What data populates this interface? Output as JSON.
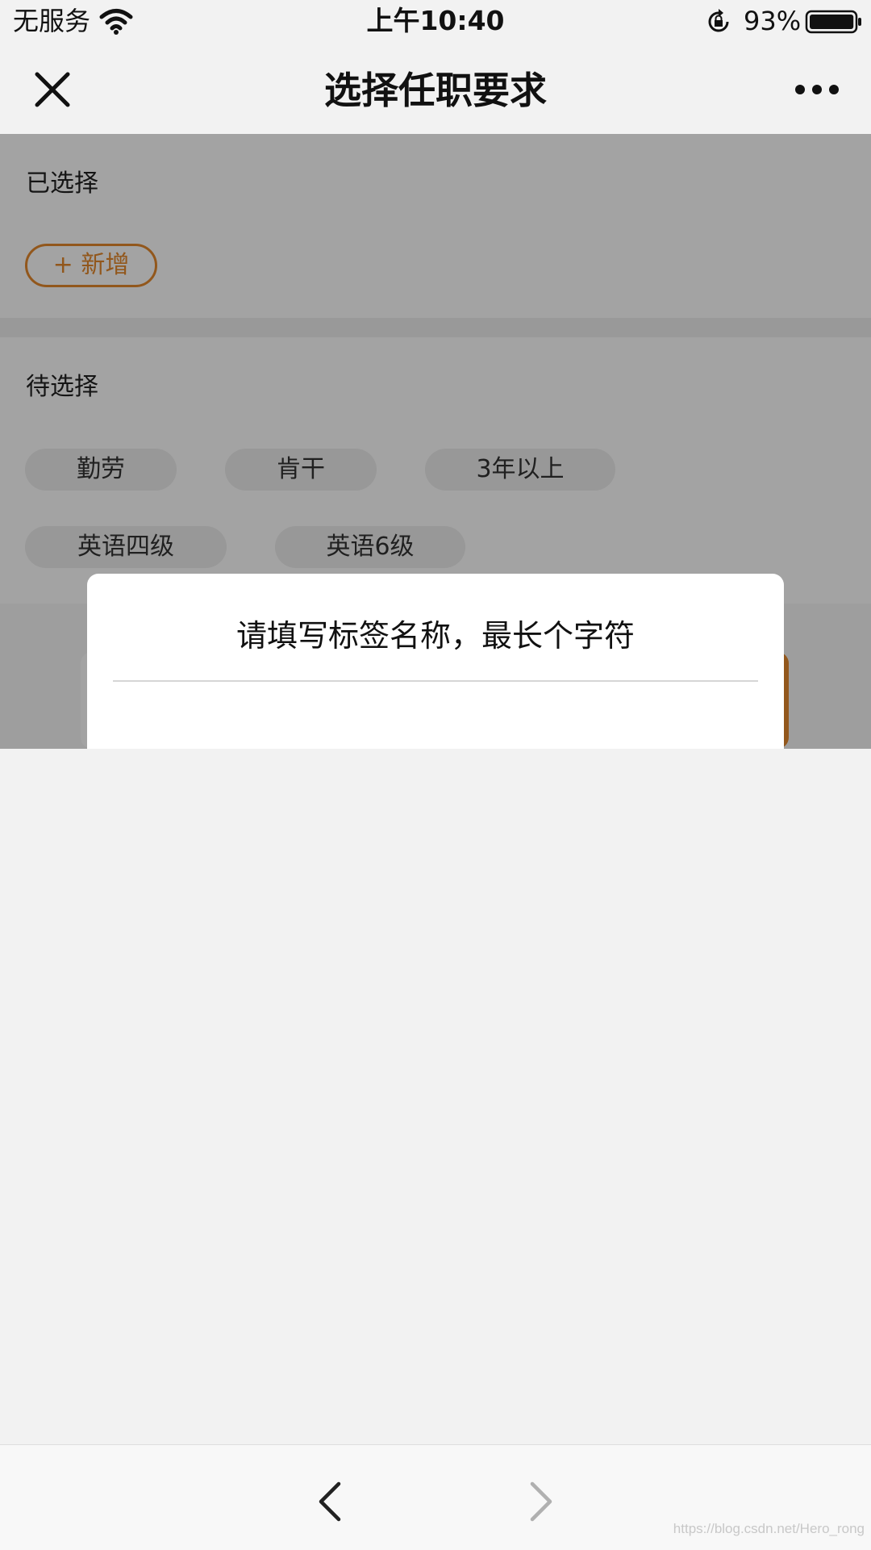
{
  "status_bar": {
    "carrier": "无服务",
    "time": "上午10:40",
    "battery_percent": "93%",
    "battery_level": 0.93
  },
  "nav": {
    "title": "选择任职要求",
    "close_icon": "close-icon",
    "more_icon": "more-icon"
  },
  "selected_section": {
    "label": "已选择",
    "add_button_label": "+ 新增"
  },
  "pending_section": {
    "label": "待选择",
    "tags": [
      "勤劳",
      "肯干",
      "3年以上",
      "英语四级",
      "英语6级"
    ]
  },
  "dialog": {
    "title": "请填写标签名称，最长个字符",
    "input_value": ""
  },
  "toolbar": {
    "back_icon": "chevron-left-icon",
    "forward_icon": "chevron-right-icon"
  },
  "watermark": "https://blog.csdn.net/Hero_rong",
  "colors": {
    "accent": "#e4892c",
    "mask": "rgba(0,0,0,0.36)"
  }
}
